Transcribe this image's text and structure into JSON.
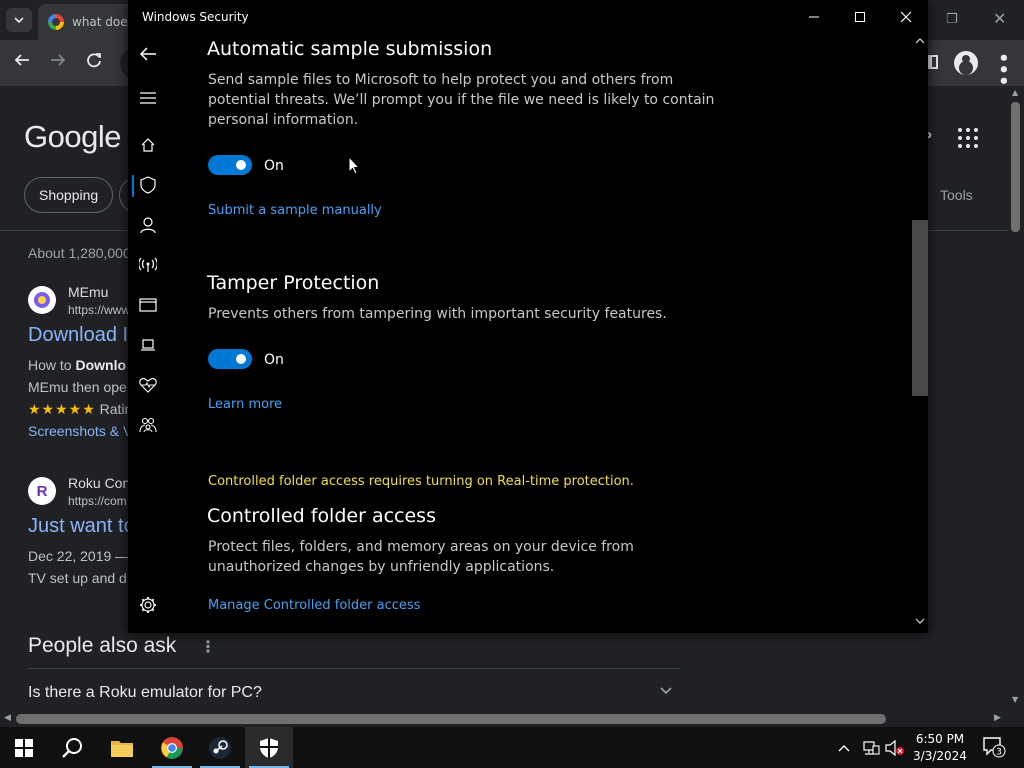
{
  "browser": {
    "tab_title": "what does",
    "chip_label": "Shopping",
    "tools_label": "Tools",
    "logo_text": "Google",
    "result_stats": "About 1,280,000",
    "results": [
      {
        "site": "MEmu",
        "url": "https://www",
        "title": "Download I",
        "line1_prefix": "How to ",
        "line1_bold": "Downlo",
        "line2": "MEmu then ope",
        "stars": "★★★★★",
        "rating_text": " Ratin",
        "line4": "Screenshots & V",
        "icon_letter": ""
      },
      {
        "site": "Roku Con",
        "url": "https://com",
        "title": "Just want to",
        "line1": "Dec 22, 2019 —",
        "line2": "TV set up and d",
        "icon_letter": "R"
      }
    ],
    "paa_title": "People also ask",
    "paa_question": "Is there a Roku emulator for PC?"
  },
  "security": {
    "window_title": "Windows Security",
    "auto_sample": {
      "heading": "Automatic sample submission",
      "description": "Send sample files to Microsoft to help protect you and others from potential threats. We’ll prompt you if the file we need is likely to contain personal information.",
      "toggle_state": "On",
      "link": "Submit a sample manually"
    },
    "tamper": {
      "heading": "Tamper Protection",
      "description": "Prevents others from tampering with important security features.",
      "toggle_state": "On",
      "link": "Learn more"
    },
    "cfa": {
      "warning": "Controlled folder access requires turning on Real-time protection.",
      "heading": "Controlled folder access",
      "description": "Protect files, folders, and memory areas on your device from unauthorized changes by unfriendly applications.",
      "link": "Manage Controlled folder access"
    },
    "accent_color": "#0078d4",
    "link_color": "#4aa0f2",
    "warning_color": "#f2df4a"
  },
  "taskbar": {
    "time": "6:50 PM",
    "date": "3/3/2024",
    "notification_count": "3"
  }
}
